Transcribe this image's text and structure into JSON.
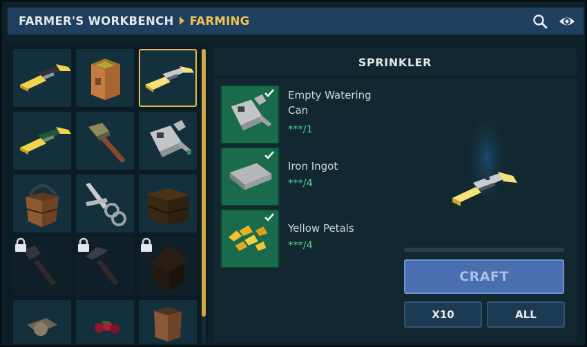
{
  "header": {
    "breadcrumb_root": "FARMER'S WORKBENCH",
    "breadcrumb_current": "FARMING",
    "icons": [
      "search-icon",
      "eye-icon"
    ]
  },
  "recipes": [
    {
      "item": "sprinkler-dark",
      "locked": false
    },
    {
      "item": "seed-planter-box",
      "locked": false
    },
    {
      "item": "sprinkler",
      "locked": false,
      "selected": true
    },
    {
      "item": "sprinkler-green",
      "locked": false
    },
    {
      "item": "hoe",
      "locked": false
    },
    {
      "item": "watering-can",
      "locked": false
    },
    {
      "item": "wooden-bucket",
      "locked": false
    },
    {
      "item": "shears",
      "locked": false
    },
    {
      "item": "wooden-crate",
      "locked": false
    },
    {
      "item": "hoe-locked",
      "locked": true
    },
    {
      "item": "pickaxe-locked",
      "locked": true
    },
    {
      "item": "birdhouse-locked",
      "locked": true
    },
    {
      "item": "fishing-reel",
      "locked": false
    },
    {
      "item": "berries",
      "locked": false
    },
    {
      "item": "bin",
      "locked": false
    }
  ],
  "detail": {
    "title": "SPRINKLER",
    "ingredients": [
      {
        "name": "Empty Watering Can",
        "quantity": "***/1",
        "icon": "watering-can-icon"
      },
      {
        "name": "Iron Ingot",
        "quantity": "***/4",
        "icon": "iron-ingot-icon"
      },
      {
        "name": "Yellow Petals",
        "quantity": "***/4",
        "icon": "yellow-petals-icon"
      }
    ],
    "craft_label": "CRAFT",
    "x10_label": "X10",
    "all_label": "ALL"
  },
  "colors": {
    "accent": "#e6b94d",
    "quantity_ok": "#4ad592",
    "craft_button": "#4a6fb0",
    "ingredient_bg": "#1a6b4b"
  }
}
